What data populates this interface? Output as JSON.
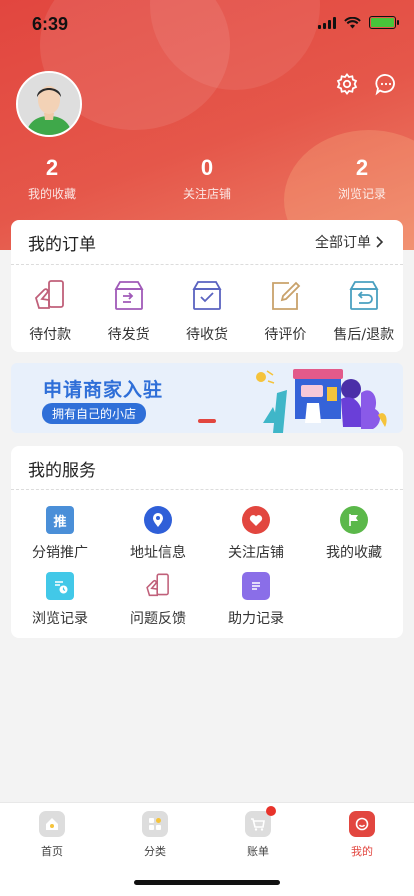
{
  "status_bar": {
    "time": "6:39"
  },
  "profile": {
    "stats": [
      {
        "value": "2",
        "label": "我的收藏"
      },
      {
        "value": "0",
        "label": "关注店铺"
      },
      {
        "value": "2",
        "label": "浏览记录"
      }
    ]
  },
  "orders": {
    "title": "我的订单",
    "all_label": "全部订单",
    "items": [
      {
        "label": "待付款",
        "icon": "wallet-hand-icon",
        "color": "#c0607a"
      },
      {
        "label": "待发货",
        "icon": "box-send-icon",
        "color": "#a05ab8"
      },
      {
        "label": "待收货",
        "icon": "box-check-icon",
        "color": "#5a63c0"
      },
      {
        "label": "待评价",
        "icon": "edit-note-icon",
        "color": "#c9a26b"
      },
      {
        "label": "售后/退款",
        "icon": "return-box-icon",
        "color": "#4aa0c0"
      }
    ]
  },
  "banner": {
    "title": "申请商家入驻",
    "subtitle": "拥有自己的小店"
  },
  "services": {
    "title": "我的服务",
    "items": [
      {
        "label": "分销推广",
        "icon": "promote-icon",
        "glyph": "推",
        "color": "#4a8fd8"
      },
      {
        "label": "地址信息",
        "icon": "location-pin-icon",
        "color": "#2f5fd8"
      },
      {
        "label": "关注店铺",
        "icon": "heart-icon",
        "color": "#e2463f"
      },
      {
        "label": "我的收藏",
        "icon": "flag-icon",
        "color": "#5bb84a"
      },
      {
        "label": "浏览记录",
        "icon": "history-doc-icon",
        "color": "#42c8e8"
      },
      {
        "label": "问题反馈",
        "icon": "feedback-hand-icon",
        "color": "#c0607a"
      },
      {
        "label": "助力记录",
        "icon": "list-doc-icon",
        "color": "#8a6ee8"
      }
    ]
  },
  "tabbar": {
    "items": [
      {
        "label": "首页",
        "icon": "home-icon"
      },
      {
        "label": "分类",
        "icon": "category-icon"
      },
      {
        "label": "账单",
        "icon": "cart-icon"
      },
      {
        "label": "我的",
        "icon": "profile-icon"
      }
    ],
    "active": "我的",
    "accent": "#e2463f"
  }
}
